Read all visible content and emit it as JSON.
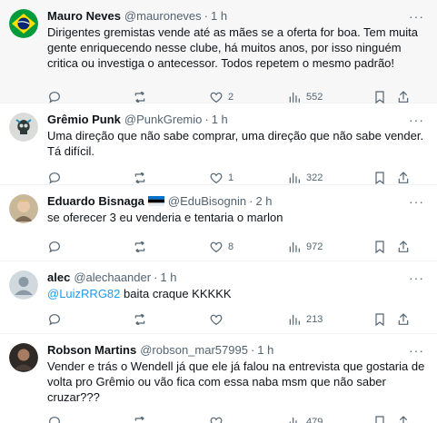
{
  "colors": {
    "accent": "#1d9bf0",
    "muted": "#536471",
    "text": "#0f1419",
    "divider": "#eff3f4"
  },
  "tweets": [
    {
      "name": "Mauro Neves",
      "handle": "@mauroneves",
      "dot": "·",
      "time": "1 h",
      "text": "Dirigentes gremistas vende até as mães se a oferta for boa. Tem muita gente enriquecendo nesse clube, há muitos anos, por isso ninguém critica ou investiga o antecessor. Todos repetem o mesmo padrão!",
      "likes": "2",
      "views": "552",
      "avatar_icon": "brazil-flag-avatar"
    },
    {
      "name": "Grêmio Punk",
      "handle": "@PunkGremio",
      "dot": "·",
      "time": "1 h",
      "text": "Uma direção que não sabe comprar, uma direção que não sabe vender. Tá difícil.",
      "likes": "1",
      "views": "322",
      "avatar_icon": "skull-avatar"
    },
    {
      "name": "Eduardo Bisnaga",
      "handle": "@EduBisognin",
      "dot": "·",
      "time": "2 h",
      "text": "se oferecer 3 eu venderia e tentaria o marlon",
      "likes": "8",
      "views": "972",
      "avatar_icon": "photo-avatar"
    },
    {
      "name": "alec",
      "handle": "@alechaander",
      "dot": "·",
      "time": "1 h",
      "mention": "@LuizRRG82",
      "text": " baita craque KKKKK",
      "likes": "",
      "views": "213",
      "avatar_icon": "default-avatar"
    },
    {
      "name": "Robson Martins",
      "handle": "@robson_mar57995",
      "dot": "·",
      "time": "1 h",
      "text": "Vender e trás o Wendell já que ele já falou na entrevista que gostaria de volta pro Grêmio ou vão fica com essa naba msm que não saber cruzar???",
      "likes": "",
      "views": "479",
      "avatar_icon": "photo-avatar"
    }
  ],
  "more_label": "···"
}
